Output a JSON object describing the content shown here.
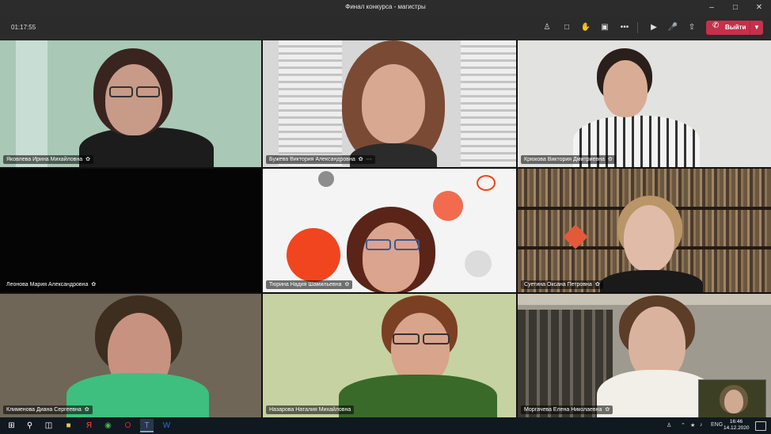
{
  "window": {
    "title": "Финал конкурса - магистры"
  },
  "toolbar": {
    "timer": "01:17:55",
    "leave_label": "Выйти"
  },
  "participants": [
    {
      "name": "Яковлева Ирина Михайловна"
    },
    {
      "name": "Бужева Виктория Александровна"
    },
    {
      "name": "Крюкова Виктория Дмитриевна"
    },
    {
      "name": "Леонова Мария Александровна"
    },
    {
      "name": "Тюрина Надия Шамильевна"
    },
    {
      "name": "Суетина Оксана Петровна"
    },
    {
      "name": "Клименова Диана Сергеевна"
    },
    {
      "name": "Назарова Наталия Михайловна"
    },
    {
      "name": "Моргачева Елена Николаевна"
    }
  ],
  "taskbar": {
    "language": "ENG",
    "time": "16:46",
    "date": "14.12.2020"
  },
  "colors": {
    "leave": "#c4314b",
    "toolbar": "#2b2b2b"
  }
}
